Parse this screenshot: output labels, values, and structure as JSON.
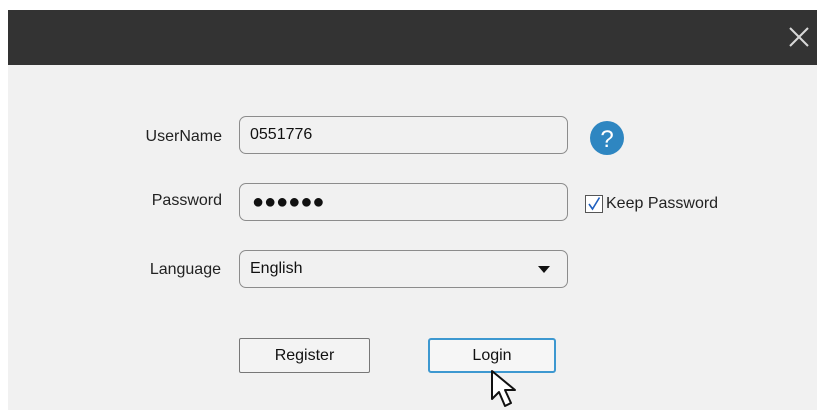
{
  "dialog": {
    "close_icon": "close-icon",
    "username": {
      "label": "UserName",
      "value": "0551776"
    },
    "password": {
      "label": "Password",
      "masked_value": "●●●●●●"
    },
    "help_icon": "question-mark-icon",
    "keep_password": {
      "label": "Keep Password",
      "checked": true
    },
    "language": {
      "label": "Language",
      "selected": "English"
    },
    "buttons": {
      "register_label": "Register",
      "login_label": "Login"
    },
    "colors": {
      "titlebar": "#333333",
      "accent": "#3d98d0",
      "help_icon": "#2e86c1",
      "background": "#f1f1f1"
    }
  }
}
